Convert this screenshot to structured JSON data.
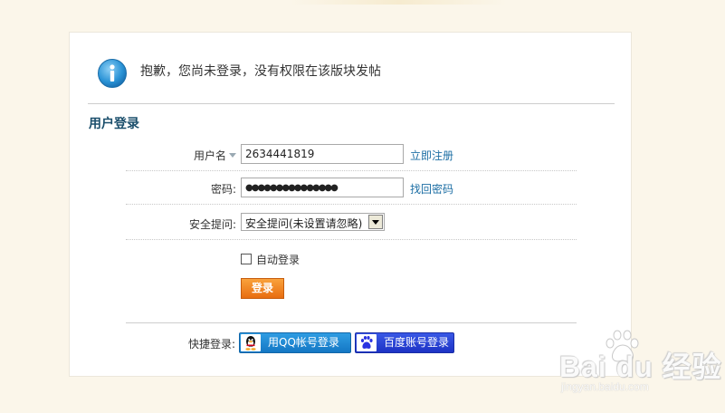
{
  "notice": {
    "icon": "info-icon",
    "message": "抱歉，您尚未登录，没有权限在该版块发帖"
  },
  "login": {
    "section_title": "用户登录",
    "username_label": "用户名",
    "username_value": "2634441819",
    "register_link": "立即注册",
    "password_label": "密码:",
    "password_value": "●●●●●●●●●●●●●●●",
    "forgot_link": "找回密码",
    "question_label": "安全提问:",
    "question_selected": "安全提问(未设置请忽略)",
    "auto_login_label": "自动登录",
    "auto_login_checked": false,
    "submit_label": "登录"
  },
  "quick_login": {
    "label": "快捷登录:",
    "qq_label": "用QQ帐号登录",
    "baidu_label": "百度账号登录"
  },
  "watermark": {
    "brand": "Bai du 经验",
    "url": "jingyan.baidu.com"
  },
  "colors": {
    "page_bg": "#fbf6ea",
    "title": "#1a4e6b",
    "link": "#1c6ea4",
    "submit": "#f08a24",
    "qq": "#1c86d3",
    "baidu": "#2843d6"
  }
}
